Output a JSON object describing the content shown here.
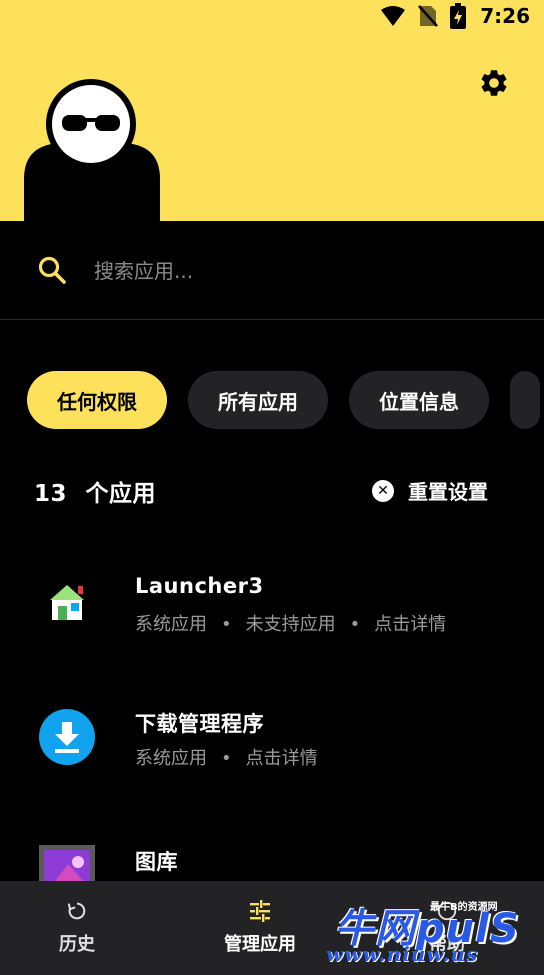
{
  "status_bar": {
    "time": "7:26",
    "icons": [
      "wifi-icon",
      "no-sim-icon",
      "battery-charging-icon"
    ]
  },
  "header": {
    "background": "#fde15a",
    "settings_icon": "gear-icon",
    "avatar": "avatar-with-sunglasses"
  },
  "search": {
    "placeholder": "搜索应用...",
    "value": ""
  },
  "filters": {
    "chips": [
      {
        "label": "任何权限",
        "active": true
      },
      {
        "label": "所有应用",
        "active": false
      },
      {
        "label": "位置信息",
        "active": false
      }
    ]
  },
  "summary": {
    "count": "13",
    "count_label": "个应用",
    "reset_label": "重置设置"
  },
  "apps": [
    {
      "name": "Launcher3",
      "tags": [
        "系统应用",
        "未支持应用",
        "点击详情"
      ],
      "icon": "launcher-house-icon"
    },
    {
      "name": "下载管理程序",
      "tags": [
        "系统应用",
        "点击详情"
      ],
      "icon": "download-icon"
    },
    {
      "name": "图库",
      "tags": [],
      "icon": "gallery-icon"
    }
  ],
  "nav": {
    "items": [
      {
        "label": "历史",
        "icon": "history-icon",
        "active": false
      },
      {
        "label": "管理应用",
        "icon": "tune-icon",
        "active": true
      },
      {
        "label": "帮助",
        "icon": "help-icon",
        "active": false
      }
    ]
  },
  "watermark": {
    "main": "牛网pulS",
    "small": "最牛B的资源网",
    "url": "www.niuw.us"
  },
  "colors": {
    "accent": "#fde15a",
    "chip_bg": "#232326",
    "nav_bg": "#232326",
    "muted_text": "#9a9a9a"
  }
}
